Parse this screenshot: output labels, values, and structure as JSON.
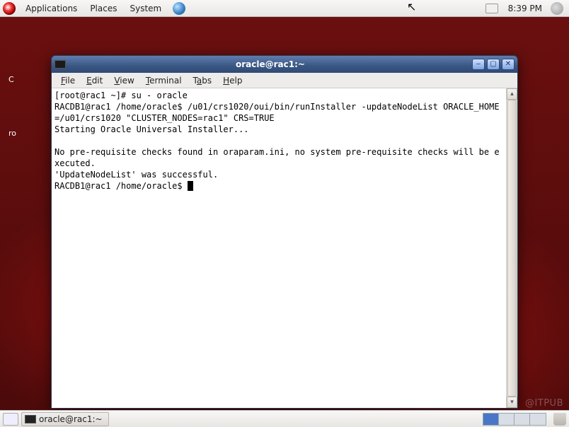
{
  "panel": {
    "menus": [
      "Applications",
      "Places",
      "System"
    ],
    "clock": "8:39 PM"
  },
  "desktop": {
    "icon1_label": "C",
    "icon2_label": "ro"
  },
  "taskbar": {
    "item_label": "oracle@rac1:~"
  },
  "watermark": "@ITPUB",
  "window": {
    "title": "oracle@rac1:~",
    "menus": [
      {
        "label": "File",
        "u": "F"
      },
      {
        "label": "Edit",
        "u": "E"
      },
      {
        "label": "View",
        "u": "V"
      },
      {
        "label": "Terminal",
        "u": "T"
      },
      {
        "label": "Tabs",
        "u": "a"
      },
      {
        "label": "Help",
        "u": "H"
      }
    ]
  },
  "terminal": {
    "lines": [
      "[root@rac1 ~]# su - oracle",
      "RACDB1@rac1 /home/oracle$ /u01/crs1020/oui/bin/runInstaller -updateNodeList ORACLE_HOME=/u01/crs1020 \"CLUSTER_NODES=rac1\" CRS=TRUE",
      "Starting Oracle Universal Installer...",
      "",
      "No pre-requisite checks found in oraparam.ini, no system pre-requisite checks will be executed.",
      "'UpdateNodeList' was successful.",
      "RACDB1@rac1 /home/oracle$ "
    ]
  }
}
